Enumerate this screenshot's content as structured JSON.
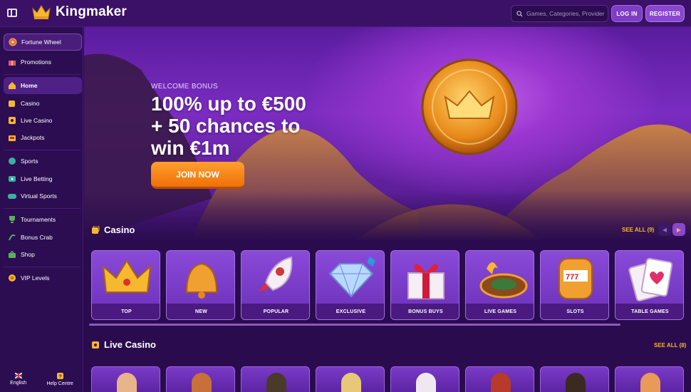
{
  "brand": {
    "name": "Kingmaker"
  },
  "search": {
    "placeholder": "Games, Categories, Providers"
  },
  "header": {
    "login_label": "LOG IN",
    "register_label": "REGISTER"
  },
  "sidebar": {
    "items": [
      {
        "label": "Fortune Wheel",
        "icon": "fortune-wheel-icon"
      },
      {
        "label": "Promotions",
        "icon": "gift-icon"
      },
      {
        "label": "Home",
        "icon": "home-icon"
      },
      {
        "label": "Casino",
        "icon": "casino-icon"
      },
      {
        "label": "Live Casino",
        "icon": "live-casino-icon"
      },
      {
        "label": "Jackpots",
        "icon": "jackpot-icon"
      },
      {
        "label": "Sports",
        "icon": "sports-ball-icon"
      },
      {
        "label": "Live Betting",
        "icon": "live-betting-icon"
      },
      {
        "label": "Virtual Sports",
        "icon": "gamepad-icon"
      },
      {
        "label": "Tournaments",
        "icon": "trophy-icon"
      },
      {
        "label": "Bonus Crab",
        "icon": "claw-icon"
      },
      {
        "label": "Shop",
        "icon": "shop-icon"
      },
      {
        "label": "VIP Levels",
        "icon": "vip-icon"
      }
    ],
    "footer": {
      "language": "English",
      "help": "Help Centre"
    }
  },
  "hero": {
    "eyebrow": "WELCOME BONUS",
    "line1": "100% up to €500",
    "line2": "+ 50 chances to",
    "line3": "win €1m",
    "cta": "JOIN NOW"
  },
  "casino": {
    "title": "Casino",
    "see_all": "SEE ALL (9)",
    "categories": [
      "TOP",
      "NEW",
      "POPULAR",
      "EXCLUSIVE",
      "BONUS BUYS",
      "LIVE GAMES",
      "SLOTS",
      "TABLE GAMES"
    ]
  },
  "live_casino": {
    "title": "Live Casino",
    "see_all": "SEE ALL (8)"
  },
  "colors": {
    "accent": "#f5b82e",
    "primary": "#8a46d0",
    "cta": "#f07008",
    "background": "#2a0c4e"
  }
}
